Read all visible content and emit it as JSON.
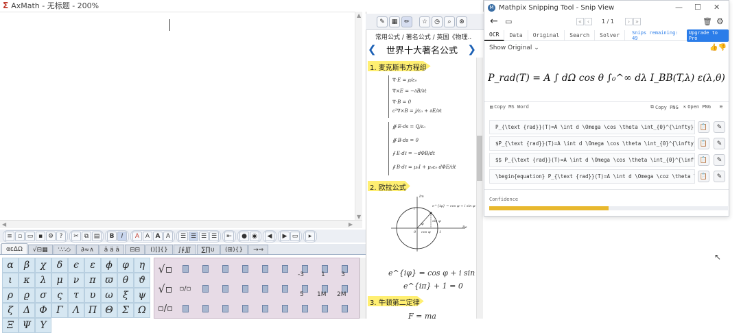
{
  "axmath": {
    "title": "AxMath - 无标题 - 200%",
    "toolbar_bold": "B",
    "toolbar_italic": "I",
    "style_buttons": [
      "A",
      "A",
      "A",
      "A"
    ],
    "tabs": [
      "αεΔΩ",
      "√⊟▦",
      "∵∴◇",
      "∂≈∧",
      "ã ä ā",
      "⊟⊟",
      "()[]{}",
      "∫∮∭",
      "∑∏∪",
      "(⊞){}",
      "→⇒"
    ],
    "greek": [
      "α",
      "β",
      "χ",
      "δ",
      "ϵ",
      "ε",
      "ϕ",
      "φ",
      "η",
      "ι",
      "κ",
      "λ",
      "μ",
      "ν",
      "π",
      "ϖ",
      "θ",
      "ϑ",
      "ρ",
      "ϱ",
      "σ",
      "ς",
      "τ",
      "υ",
      "ω",
      "ξ",
      "ψ",
      "ζ",
      "Δ",
      "Φ",
      "Γ",
      "Λ",
      "Π",
      "Θ",
      "Σ",
      "Ω",
      "Ξ",
      "Ψ",
      "Υ"
    ],
    "template_labels": [
      "-3",
      "1",
      "3",
      "5",
      "1M",
      "2M"
    ]
  },
  "library": {
    "breadcrumb": "常用公式 / 著名公式 / 英国《物理...",
    "title": "世界十大著名公式",
    "nav_prev": "❮",
    "nav_next": "❯",
    "sections": [
      "1. 麦克斯韦方程组",
      "2. 欧拉公式",
      "3. 牛顿第二定律"
    ],
    "maxwell_lines": [
      "∇·E = ρ/ε₀",
      "∇×E = −∂B/∂t",
      "∇·B = 0",
      "c²∇×B = j/ε₀ + ∂E/∂t",
      "∯ E·ds = Q/ε₀",
      "∯ B·ds = 0",
      "∮ E·dℓ = −dΦB/dt",
      "∮ B·dℓ = μ₀I + μ₀ε₀ dΦE/dt"
    ],
    "euler_diagram_labels": [
      "Im",
      "e^{iφ} = cos φ + i sin φ",
      "Re",
      "cos φ",
      "sin φ",
      "φ",
      "1",
      "0",
      "i"
    ],
    "euler_formula": "e^{iφ} = cos φ + i sin φ",
    "euler_identity": "e^{iπ} + 1 = 0",
    "newton_formula": "F = ma"
  },
  "mathpix": {
    "title": "Mathpix Snipping Tool - Snip View",
    "page_indicator": "1 / 1",
    "tabs": [
      "OCR",
      "Data",
      "Original",
      "Search",
      "Solver"
    ],
    "snips_remaining_label": "Snips remaining",
    "snips_remaining_value": "49",
    "upgrade_label": "Upgrade to Pro",
    "show_original": "Show Original",
    "formula": "P_rad(T) = A ∫ dΩ cos θ ∫₀^∞ dλ I_BB(T,λ) ε(λ,θ)",
    "copy_ms_word": "Copy MS Word",
    "copy_png": "Copy PNG",
    "open_png": "Open PNG",
    "results": [
      "P_{\\text {rad}}(T)=A \\int d \\Omega \\cos \\theta \\int_{0}^{\\infty} d",
      "$P_{\\text {rad}}(T)=A \\int d \\Omega \\cos \\theta \\int_{0}^{\\infty} d",
      "$$  P_{\\text {rad}}(T)=A \\int d \\Omega \\cos \\theta \\int_{0}^{\\infty",
      "\\begin{equation}  P_{\\text {rad}}(T)=A \\int d \\Omega \\coz \\theta \\i"
    ],
    "confidence_label": "Confidence",
    "confidence_value": 0.5
  },
  "colors": {
    "section_highlight": "#ffef72",
    "mathpix_accent": "#2b7de9",
    "confidence_bar": "#e8b82e",
    "greek_key": "#d6e7f2",
    "template_panel": "#e7dbe6"
  }
}
